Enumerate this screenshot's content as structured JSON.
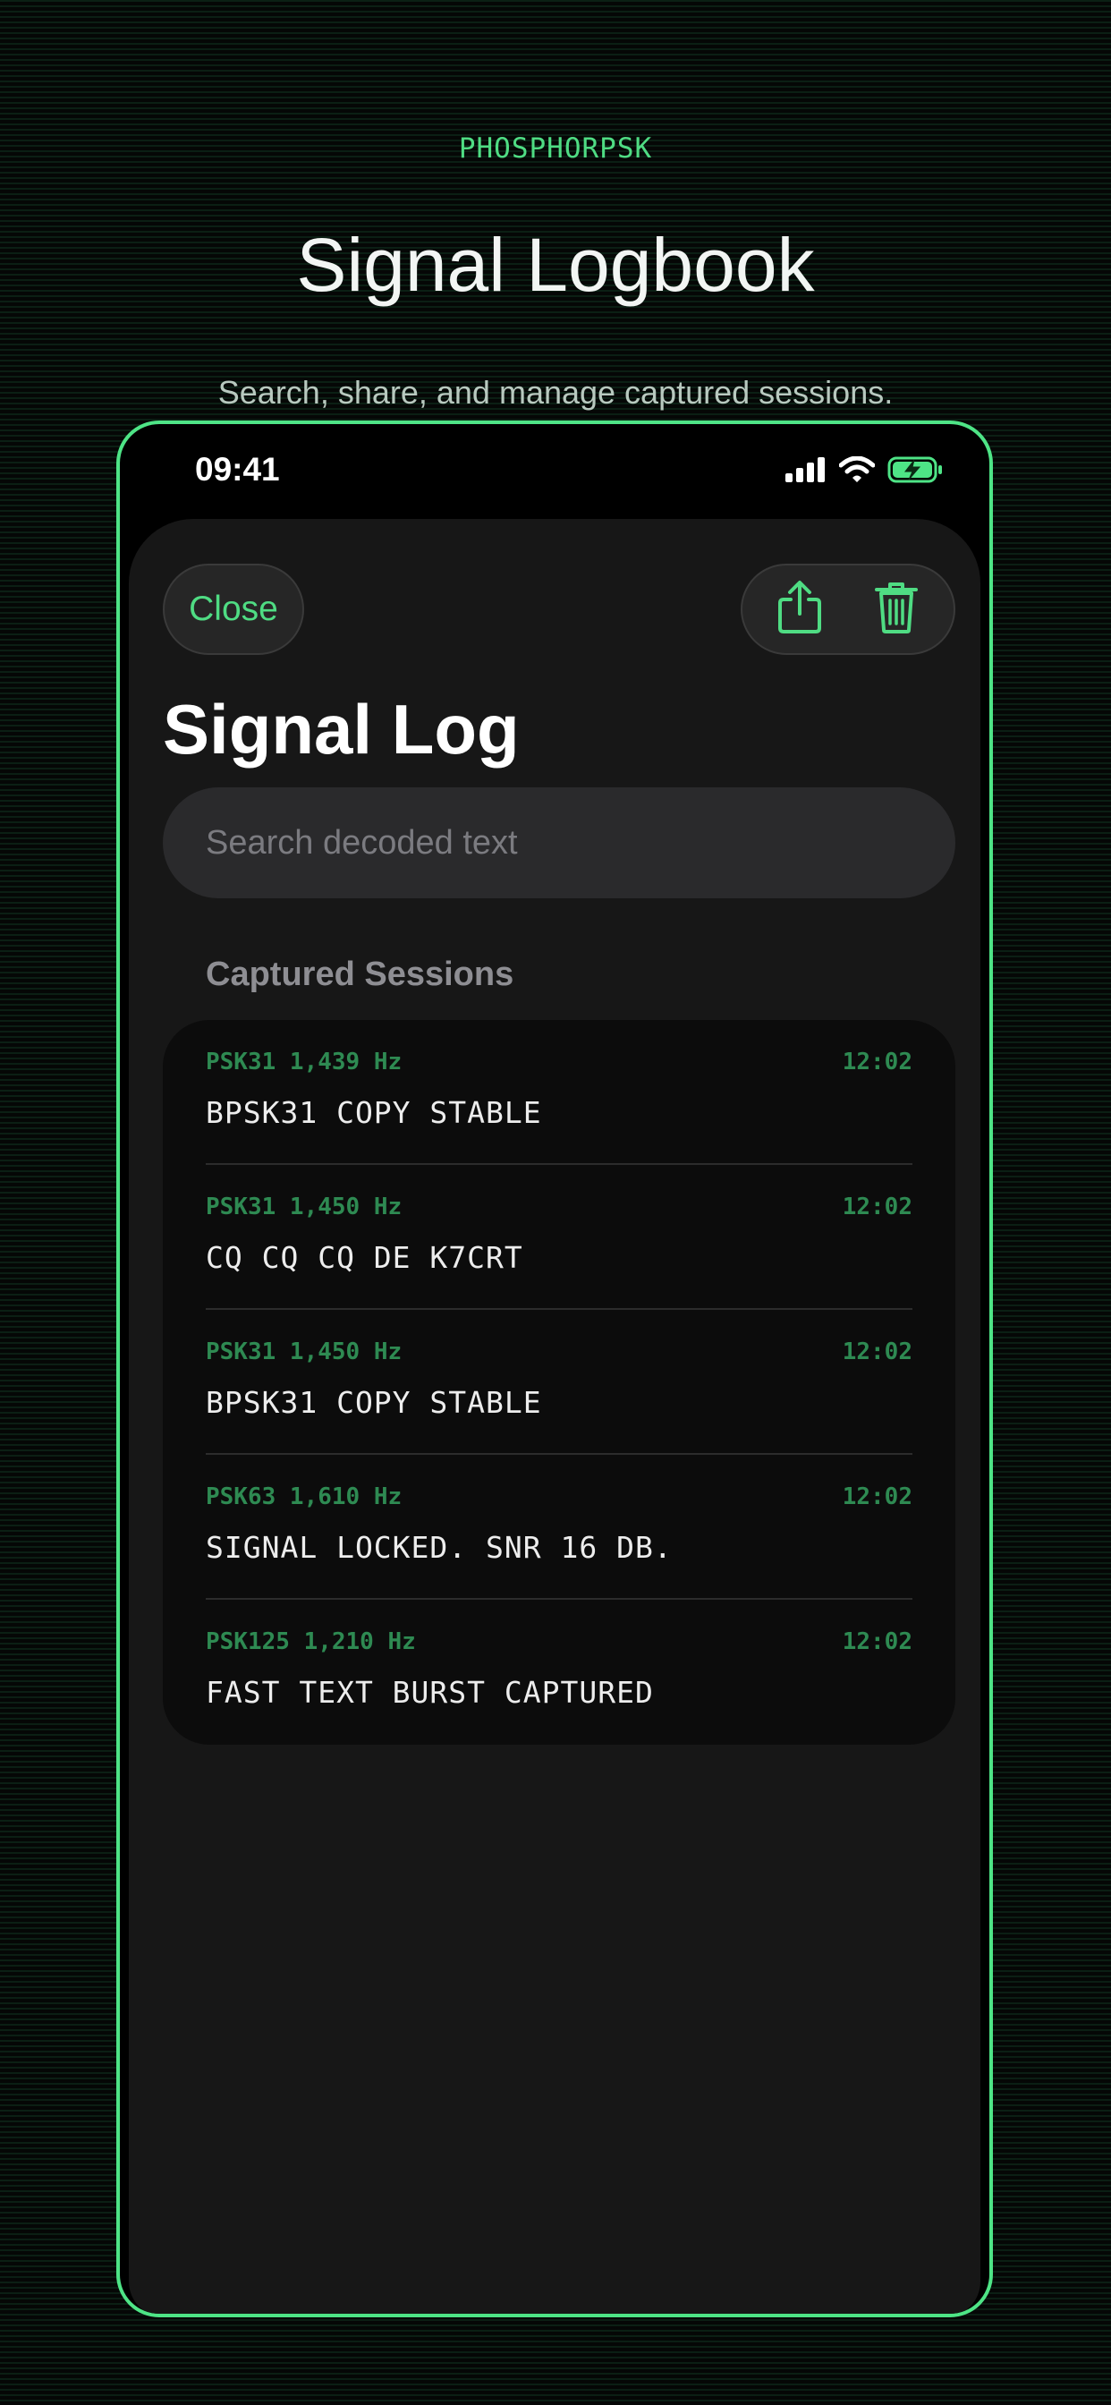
{
  "promo": {
    "brand": "PHOSPHORPSK",
    "headline": "Signal Logbook",
    "subhead": "Search, share, and manage captured sessions."
  },
  "status_bar": {
    "time": "09:41",
    "icons": [
      "cellular-signal-icon",
      "wifi-icon",
      "battery-charging-icon"
    ]
  },
  "sheet": {
    "close_label": "Close",
    "actions": [
      "share-icon",
      "trash-icon"
    ],
    "title": "Signal Log",
    "search": {
      "placeholder": "Search decoded text",
      "value": ""
    },
    "section_header": "Captured Sessions",
    "sessions": [
      {
        "meta": "PSK31 1,439 Hz",
        "time": "12:02",
        "text": "BPSK31 COPY STABLE"
      },
      {
        "meta": "PSK31 1,450 Hz",
        "time": "12:02",
        "text": "CQ CQ CQ DE K7CRT"
      },
      {
        "meta": "PSK31 1,450 Hz",
        "time": "12:02",
        "text": "BPSK31 COPY STABLE"
      },
      {
        "meta": "PSK63 1,610 Hz",
        "time": "12:02",
        "text": "SIGNAL LOCKED. SNR 16 DB."
      },
      {
        "meta": "PSK125 1,210 Hz",
        "time": "12:02",
        "text": "FAST TEXT BURST CAPTURED"
      }
    ]
  },
  "colors": {
    "accent": "#4fdc83",
    "frame": "#4ee486",
    "row_meta": "#2e8a52",
    "background": "#050706"
  }
}
